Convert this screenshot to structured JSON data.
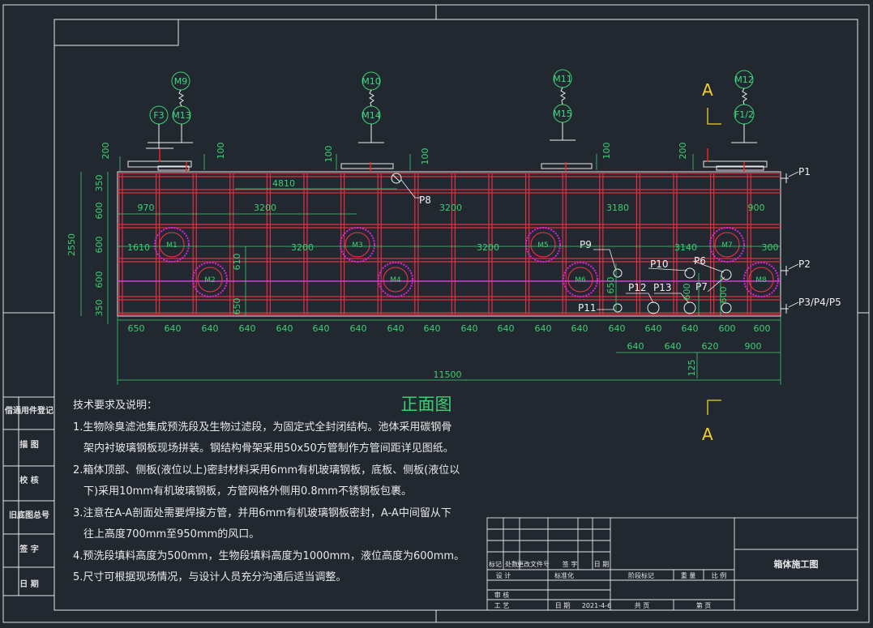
{
  "title": "正面图",
  "section_label": "A",
  "drawing_name": "箱体施工图",
  "date": "2021-4-6",
  "instruments": {
    "m9": "M9",
    "f3": "F3",
    "m13": "M13",
    "m10": "M10",
    "m14": "M14",
    "m11": "M11",
    "m15": "M15",
    "m12": "M12",
    "f12": "F1/2"
  },
  "modules": [
    "M1",
    "M2",
    "M3",
    "M4",
    "M5",
    "M6",
    "M7",
    "M8"
  ],
  "ports": [
    "P1",
    "P2",
    "P3/P4/P5",
    "P6",
    "P7",
    "P8",
    "P9",
    "P10",
    "P11",
    "P12",
    "P13"
  ],
  "dims": {
    "top": [
      "200",
      "100",
      "100",
      "100",
      "100",
      "200"
    ],
    "height_left": [
      "350",
      "600",
      "600",
      "600",
      "350"
    ],
    "height_total": "2550",
    "row1": [
      "4810"
    ],
    "row2": [
      "970",
      "3200",
      "3200",
      "3180",
      "900"
    ],
    "row3": [
      "1610",
      "3200",
      "3200",
      "3140",
      "300"
    ],
    "inner": [
      "610",
      "650",
      "650",
      "600",
      "600"
    ],
    "bottom1": [
      "650",
      "640",
      "640",
      "640",
      "640",
      "640",
      "640",
      "640",
      "640",
      "640",
      "640",
      "640",
      "640",
      "640",
      "640",
      "640",
      "600",
      "600"
    ],
    "bottom2": [
      "640",
      "640",
      "620",
      "900"
    ],
    "small": "125",
    "total": "11500"
  },
  "notes": [
    {
      "text": "技术要求及说明：",
      "indent": false
    },
    {
      "text": "1.生物除臭滤池集成预洗段及生物过滤段，为固定式全封闭结构。池体采用碳钢骨",
      "indent": false
    },
    {
      "text": "架内衬玻璃钢板现场拼装。钢结构骨架采用50x50方管制作方管间距详见图纸。",
      "indent": true
    },
    {
      "text": "2.箱体顶部、侧板(液位以上)密封材料采用6mm有机玻璃钢板，底板、侧板(液位以",
      "indent": false
    },
    {
      "text": "下)采用10mm有机玻璃钢板，方管网格外侧用0.8mm不锈钢板包裹。",
      "indent": true
    },
    {
      "text": "3.注意在A-A剖面处需要焊接方管，并用6mm有机玻璃钢板密封，A-A中间留从下",
      "indent": false
    },
    {
      "text": "往上高度700mm至950mm的风口。",
      "indent": true
    },
    {
      "text": "4.预洗段填料高度为500mm，生物段填料高度为1000mm，液位高度为600mm。",
      "indent": false
    },
    {
      "text": "5.尺寸可根据现场情况，与设计人员充分沟通后适当调整。",
      "indent": false
    }
  ],
  "side_labels": [
    "借通用件登记",
    "描  图",
    "校  核",
    "旧底图总号",
    "签  字",
    "日  期"
  ],
  "title_block": {
    "mark_cols": [
      "标记",
      "处数",
      "更改文件号",
      "签  字",
      "日  期"
    ],
    "design": "设 计",
    "standard": "标准化",
    "stage": "阶段标记",
    "weight": "重  量",
    "scale": "比 例",
    "review": "审 核",
    "process": "工 艺",
    "date_label": "日 期",
    "sheets_total": "共    页",
    "sheet_no": "第    页"
  }
}
